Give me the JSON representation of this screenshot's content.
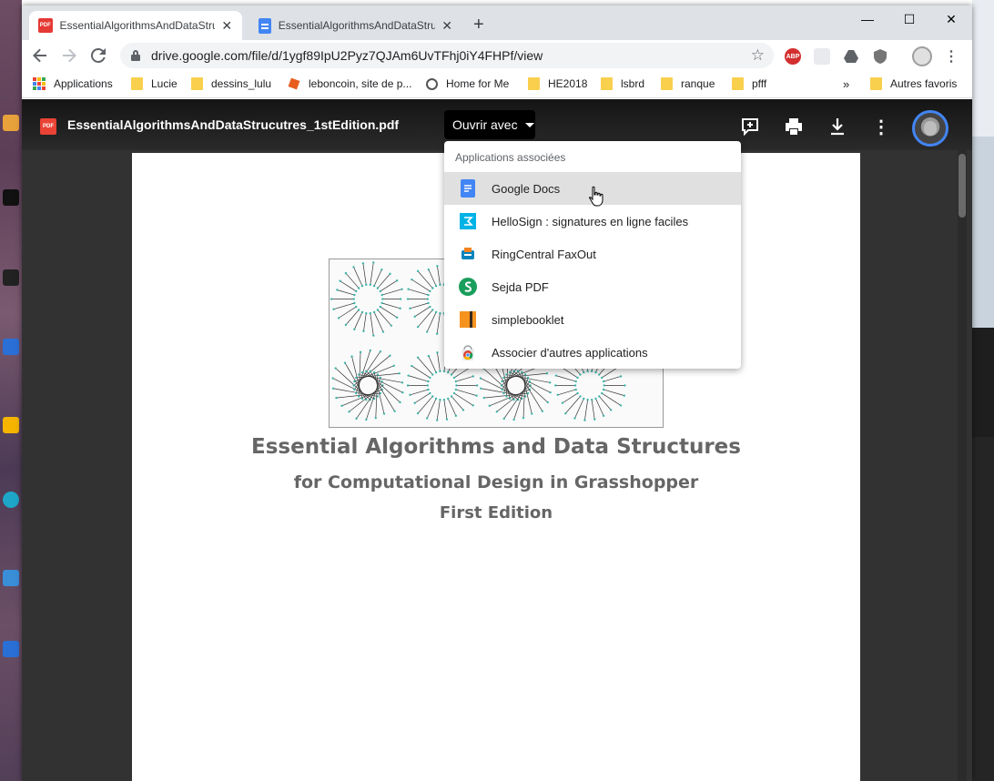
{
  "browser": {
    "tabs": [
      {
        "title": "EssentialAlgorithmsAndDataStruc",
        "active": true,
        "favicon": "pdf-icon"
      },
      {
        "title": "EssentialAlgorithmsAndDataStruc",
        "active": false,
        "favicon": "google-docs-icon"
      }
    ],
    "new_tab": "+",
    "window_controls": {
      "minimize": "—",
      "maximize": "☐",
      "close": "✕"
    },
    "url": "drive.google.com/file/d/1ygf89IpU2Pyz7QJAm6UvTFhj0iY4FHPf/view",
    "extensions": [
      {
        "name": "adblock-plus-icon",
        "label": "ABP"
      }
    ],
    "bookmarks": [
      {
        "label": "Applications",
        "icon": "apps-grid-icon"
      },
      {
        "label": "Lucie",
        "icon": "folder-icon"
      },
      {
        "label": "dessins_lulu",
        "icon": "folder-icon"
      },
      {
        "label": "leboncoin, site de p...",
        "icon": "leboncoin-icon"
      },
      {
        "label": "Home for Me",
        "icon": "globe-icon"
      },
      {
        "label": "HE2018",
        "icon": "folder-icon"
      },
      {
        "label": "lsbrd",
        "icon": "folder-icon"
      },
      {
        "label": "ranque",
        "icon": "folder-icon"
      },
      {
        "label": "pfff",
        "icon": "folder-icon"
      }
    ],
    "bookmarks_overflow": "»",
    "other_bookmarks": "Autres favoris"
  },
  "viewer": {
    "file_name": "EssentialAlgorithmsAndDataStrucutres_1stEdition.pdf",
    "file_icon_label": "PDF",
    "open_with_label": "Ouvrir avec",
    "tools": [
      "add-to-drive-icon",
      "print-icon",
      "download-icon",
      "more-options-icon"
    ]
  },
  "document": {
    "title": "Essential Algorithms and Data Structures",
    "subtitle": "for Computational Design in Grasshopper",
    "edition": "First Edition"
  },
  "open_with_menu": {
    "header": "Applications associées",
    "items": [
      {
        "label": "Google Docs",
        "icon": "google-docs-icon",
        "hovered": true
      },
      {
        "label": "HelloSign : signatures en ligne faciles",
        "icon": "hellosign-icon"
      },
      {
        "label": "RingCentral FaxOut",
        "icon": "ringcentral-icon"
      },
      {
        "label": "Sejda PDF",
        "icon": "sejda-icon"
      },
      {
        "label": "simplebooklet",
        "icon": "simplebooklet-icon"
      },
      {
        "label": "Associer d'autres applications",
        "icon": "chrome-web-store-icon"
      }
    ]
  },
  "colors": {
    "viewer_bg": "#323232",
    "menu_hover": "#e0e0e0",
    "google_blue": "#4285f4",
    "pdf_red": "#ea4335",
    "sejda_green": "#1a9e5c",
    "hellosign_cyan": "#00b3e6"
  }
}
